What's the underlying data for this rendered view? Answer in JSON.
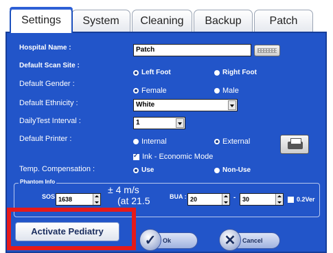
{
  "tabs": [
    {
      "label": "Settings",
      "active": true
    },
    {
      "label": "System",
      "active": false
    },
    {
      "label": "Cleaning",
      "active": false
    },
    {
      "label": "Backup",
      "active": false
    },
    {
      "label": "Patch",
      "active": false
    }
  ],
  "form": {
    "hospital_name_label": "Hospital Name :",
    "hospital_name_value": "Patch",
    "scan_site_label": "Default Scan Site :",
    "scan_site_left": "Left Foot",
    "scan_site_right": "Right Foot",
    "gender_label": "Default Gender :",
    "gender_female": "Female",
    "gender_male": "Male",
    "ethnicity_label": "Default Ethnicity :",
    "ethnicity_value": "White",
    "interval_label": "DailyTest Interval :",
    "interval_value": "1",
    "printer_label": "Default Printer :",
    "printer_internal": "Internal",
    "printer_external": "External",
    "ink_mode": "Ink - Economic Mode",
    "temp_label": "Temp. Compensation :",
    "temp_use": "Use",
    "temp_nonuse": "Non-Use"
  },
  "phantom": {
    "title": "Phantom Info",
    "sos_label": "SOS :",
    "sos_value": "1638",
    "tol_line1": "± 4 m/s",
    "tol_line2": "(at 21.5",
    "bua_label": "BUA :",
    "bua_min": "20",
    "bua_sep": "-",
    "bua_max": "30",
    "ver_label": "0.2Ver"
  },
  "actions": {
    "activate": "Activate Pediatry",
    "ok": "Ok",
    "cancel": "Cancel"
  },
  "colors": {
    "panel": "#2255c9",
    "highlight": "#e51a1a"
  }
}
